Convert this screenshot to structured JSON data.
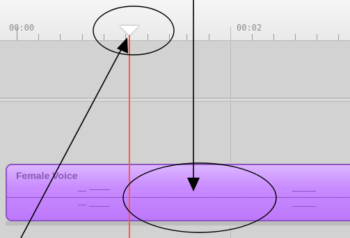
{
  "ruler": {
    "labels": [
      "00:00",
      "00:02"
    ]
  },
  "clip": {
    "title": "Female Voice",
    "color": "#c98cff"
  },
  "playhead": {
    "color": "#ff5a3c"
  }
}
